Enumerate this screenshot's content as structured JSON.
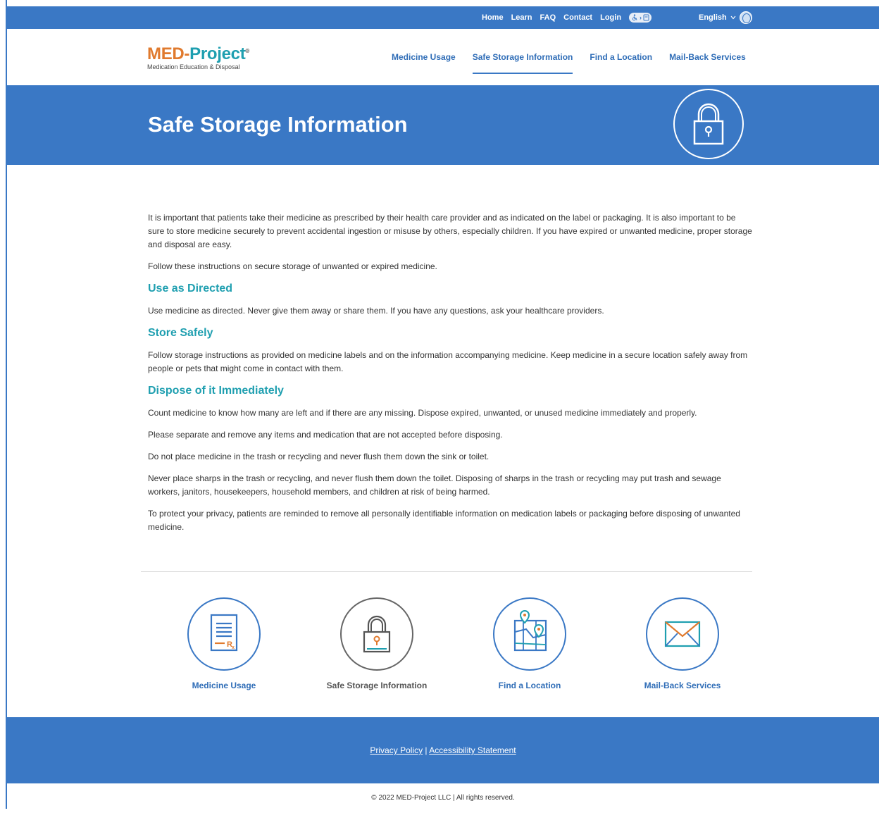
{
  "topbar": {
    "links": [
      "Home",
      "Learn",
      "FAQ",
      "Contact",
      "Login"
    ],
    "language": "English",
    "icons": [
      "accessibility-toggle-icon",
      "chevron-down-icon",
      "globe-icon"
    ]
  },
  "header": {
    "logo_text_1": "MED-",
    "logo_text_2": "Project",
    "logo_reg": "®",
    "logo_sub": "Medication Education & Disposal",
    "nav": [
      "Medicine Usage",
      "Safe Storage Information",
      "Find a Location",
      "Mail-Back Services"
    ],
    "active_nav": "Safe Storage Information"
  },
  "hero": {
    "title": "Safe Storage Information",
    "icon": "lock-icon"
  },
  "content": {
    "intro": "It is important that patients take their medicine as prescribed by their health care provider and as indicated on the label or packaging. It is also important to be sure to store medicine securely to prevent accidental ingestion or misuse by others, especially children. If you have expired or unwanted medicine, proper storage and disposal are easy.",
    "follow": "Follow these instructions on secure storage of unwanted or expired medicine.",
    "sections": [
      {
        "heading": "Use as Directed",
        "paragraphs": [
          "Use medicine as directed. Never give them away or share them. If you have any questions, ask your healthcare providers."
        ]
      },
      {
        "heading": "Store Safely",
        "paragraphs": [
          "Follow storage instructions as provided on medicine labels and on the information accompanying medicine. Keep medicine in a secure location safely away from people or pets that might come in contact with them."
        ]
      },
      {
        "heading": "Dispose of it Immediately",
        "paragraphs": [
          "Count medicine to know how many are left and if there are any missing. Dispose expired, unwanted, or unused medicine immediately and properly.",
          "Please separate and remove any items and medication that are not accepted before disposing.",
          "Do not place medicine in the trash or recycling and never flush them down the sink or toilet.",
          "Never place sharps in the trash or recycling, and never flush them down the toilet. Disposing of sharps in the trash or recycling may put trash and sewage workers, janitors, housekeepers, household members, and children at risk of being harmed.",
          "To protect your privacy, patients are reminded to remove all personally identifiable information on medication labels or packaging before disposing of unwanted medicine."
        ]
      }
    ]
  },
  "quick_links": [
    {
      "label": "Medicine Usage",
      "icon": "prescription-document-icon"
    },
    {
      "label": "Safe Storage Information",
      "icon": "lock-icon"
    },
    {
      "label": "Find a Location",
      "icon": "map-pin-icon"
    },
    {
      "label": "Mail-Back Services",
      "icon": "envelope-icon"
    }
  ],
  "footer": {
    "privacy": "Privacy Policy",
    "separator": "|",
    "accessibility": "Accessibility Statement",
    "copyright": "© 2022 MED-Project LLC | All rights reserved."
  },
  "colors": {
    "brand_blue": "#3a78c5",
    "link_blue": "#2f6db7",
    "teal": "#1f9fb0",
    "orange": "#e07a2e"
  }
}
